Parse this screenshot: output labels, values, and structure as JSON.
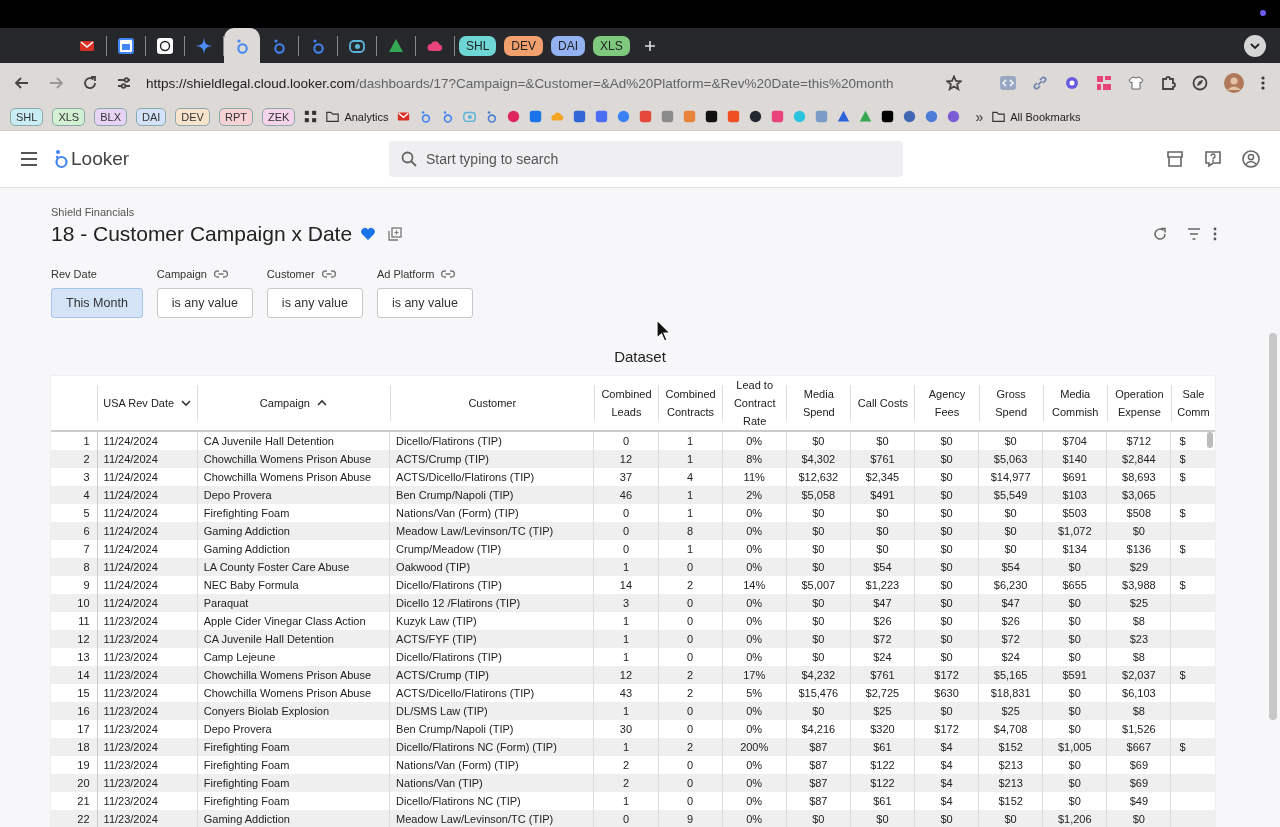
{
  "browser": {
    "tabs": [
      {
        "kind": "envelope",
        "color": "#d93025",
        "selected": false
      },
      {
        "kind": "calendar",
        "color": "#4285f4",
        "selected": false
      },
      {
        "kind": "knot",
        "color": "#ffffff",
        "selected": false
      },
      {
        "kind": "sparkle",
        "color": "#4c8df6",
        "selected": false
      },
      {
        "kind": "ring",
        "color": "#4285f4",
        "selected": true
      },
      {
        "kind": "ring",
        "color": "#4285f4",
        "selected": false
      },
      {
        "kind": "ring",
        "color": "#4285f4",
        "selected": false
      },
      {
        "kind": "lens",
        "color": "#5bb4d9",
        "selected": false
      },
      {
        "kind": "triangle",
        "color": "#34a853",
        "selected": false
      },
      {
        "kind": "cloud",
        "color": "#e8437a",
        "selected": false
      },
      {
        "kind": "chip",
        "label": "SHL",
        "color": "#6fd6d6",
        "selected": false
      },
      {
        "kind": "chip",
        "label": "DEV",
        "color": "#f2a06e",
        "selected": false
      },
      {
        "kind": "chip",
        "label": "DAI",
        "color": "#92b2f2",
        "selected": false
      },
      {
        "kind": "chip",
        "label": "XLS",
        "color": "#7fc97f",
        "selected": false
      }
    ],
    "url": {
      "host": "https://shieldlegal.cloud.looker.com",
      "path": "/dashboards/17?Campaign=&Customer=&Ad%20Platform=&Rev%20Date=this%20month"
    },
    "bookmarks": [
      {
        "kind": "chip",
        "label": "SHL",
        "color": "#c9ecf5"
      },
      {
        "kind": "chip",
        "label": "XLS",
        "color": "#d3f0d3"
      },
      {
        "kind": "chip",
        "label": "BLX",
        "color": "#e6d3f5"
      },
      {
        "kind": "chip",
        "label": "DAI",
        "color": "#d3e2f8"
      },
      {
        "kind": "chip",
        "label": "DEV",
        "color": "#f8e3cc"
      },
      {
        "kind": "chip",
        "label": "RPT",
        "color": "#f8d3d3"
      },
      {
        "kind": "chip",
        "label": "ZEK",
        "color": "#f5d3ea"
      },
      {
        "kind": "grid",
        "color": "#333333"
      },
      {
        "kind": "folder",
        "label": "Analytics"
      },
      {
        "kind": "envelope",
        "color": "#d93025"
      },
      {
        "kind": "ring",
        "color": "#4285f4"
      },
      {
        "kind": "ring",
        "color": "#4285f4"
      },
      {
        "kind": "lens",
        "color": "#5bb4d9"
      },
      {
        "kind": "ring",
        "color": "#4d7fd6"
      },
      {
        "kind": "circle",
        "color": "#e0245e"
      },
      {
        "kind": "square",
        "color": "#1a73e8"
      },
      {
        "kind": "cloud",
        "color": "#f4a623"
      },
      {
        "kind": "square",
        "color": "#3367d6"
      },
      {
        "kind": "square",
        "color": "#4c6ef5"
      },
      {
        "kind": "circle",
        "color": "#3b82f6"
      },
      {
        "kind": "square",
        "color": "#e5483b"
      },
      {
        "kind": "square",
        "color": "#8a8a8a"
      },
      {
        "kind": "square",
        "color": "#e8833a"
      },
      {
        "kind": "square",
        "color": "#111111"
      },
      {
        "kind": "square",
        "color": "#f04e23"
      },
      {
        "kind": "circle",
        "color": "#24292f"
      },
      {
        "kind": "square",
        "color": "#e8437a"
      },
      {
        "kind": "circle",
        "color": "#2ac3de"
      },
      {
        "kind": "square",
        "color": "#7a9cc6"
      },
      {
        "kind": "triangle",
        "color": "#2b63d9"
      },
      {
        "kind": "triangle",
        "color": "#34a853"
      },
      {
        "kind": "square",
        "color": "#000000"
      },
      {
        "kind": "circle",
        "color": "#4267b2"
      },
      {
        "kind": "circle",
        "color": "#4a7bd8"
      },
      {
        "kind": "circle",
        "color": "#7c5cd6"
      },
      {
        "kind": "more",
        "label": "»"
      },
      {
        "kind": "folder",
        "label": "All Bookmarks"
      }
    ]
  },
  "app": {
    "brand": "Looker",
    "search": {
      "placeholder": "Start typing to search"
    }
  },
  "dashboard": {
    "breadcrumb": "Shield Financials",
    "title": "18 - Customer Campaign x Date",
    "favorite": true,
    "filters": [
      {
        "label": "Rev Date",
        "value": "This Month",
        "active": true,
        "linked": false
      },
      {
        "label": "Campaign",
        "value": "is any value",
        "active": false,
        "linked": true
      },
      {
        "label": "Customer",
        "value": "is any value",
        "active": false,
        "linked": true
      },
      {
        "label": "Ad Platform",
        "value": "is any value",
        "active": false,
        "linked": true
      }
    ]
  },
  "tile": {
    "title": "Dataset",
    "columns": [
      {
        "label": "USA Rev Date",
        "kind": "text",
        "sorted": true,
        "descending": true
      },
      {
        "label": "Campaign",
        "kind": "text",
        "sorted": true,
        "descending": false
      },
      {
        "label": "Customer",
        "kind": "text",
        "sorted": false
      },
      {
        "label": "Combined Leads",
        "kind": "num",
        "sorted": false
      },
      {
        "label": "Combined Contracts",
        "kind": "num",
        "sorted": false
      },
      {
        "label": "Lead to Contract Rate",
        "kind": "num",
        "sorted": false
      },
      {
        "label": "Media Spend",
        "kind": "num",
        "sorted": false
      },
      {
        "label": "Call Costs",
        "kind": "num",
        "sorted": false
      },
      {
        "label": "Agency Fees",
        "kind": "num",
        "sorted": false
      },
      {
        "label": "Gross Spend",
        "kind": "num",
        "sorted": false
      },
      {
        "label": "Media Commish",
        "kind": "num",
        "sorted": false
      },
      {
        "label": "Operation Expense",
        "kind": "num",
        "sorted": false
      },
      {
        "label": "Sale Comm",
        "kind": "cut",
        "sorted": false
      }
    ],
    "rows": [
      {
        "n": "1",
        "cells": [
          "11/24/2024",
          "CA Juvenile Hall Detention",
          "Dicello/Flatirons (TIP)",
          "0",
          "1",
          "0%",
          "$0",
          "$0",
          "$0",
          "$0",
          "$704",
          "$712",
          "$"
        ]
      },
      {
        "n": "2",
        "cells": [
          "11/24/2024",
          "Chowchilla Womens Prison Abuse",
          "ACTS/Crump (TIP)",
          "12",
          "1",
          "8%",
          "$4,302",
          "$761",
          "$0",
          "$5,063",
          "$140",
          "$2,844",
          "$"
        ]
      },
      {
        "n": "3",
        "cells": [
          "11/24/2024",
          "Chowchilla Womens Prison Abuse",
          "ACTS/Dicello/Flatirons (TIP)",
          "37",
          "4",
          "11%",
          "$12,632",
          "$2,345",
          "$0",
          "$14,977",
          "$691",
          "$8,693",
          "$"
        ]
      },
      {
        "n": "4",
        "cells": [
          "11/24/2024",
          "Depo Provera",
          "Ben Crump/Napoli (TIP)",
          "46",
          "1",
          "2%",
          "$5,058",
          "$491",
          "$0",
          "$5,549",
          "$103",
          "$3,065"
        ]
      },
      {
        "n": "5",
        "cells": [
          "11/24/2024",
          "Firefighting Foam",
          "Nations/Van (Form) (TIP)",
          "0",
          "1",
          "0%",
          "$0",
          "$0",
          "$0",
          "$0",
          "$503",
          "$508",
          "$"
        ]
      },
      {
        "n": "6",
        "cells": [
          "11/24/2024",
          "Gaming Addiction",
          "Meadow Law/Levinson/TC (TIP)",
          "0",
          "8",
          "0%",
          "$0",
          "$0",
          "$0",
          "$0",
          "$1,072",
          "$0"
        ]
      },
      {
        "n": "7",
        "cells": [
          "11/24/2024",
          "Gaming Addiction",
          "Crump/Meadow (TIP)",
          "0",
          "1",
          "0%",
          "$0",
          "$0",
          "$0",
          "$0",
          "$134",
          "$136",
          "$"
        ]
      },
      {
        "n": "8",
        "cells": [
          "11/24/2024",
          "LA County Foster Care Abuse",
          "Oakwood (TIP)",
          "1",
          "0",
          "0%",
          "$0",
          "$54",
          "$0",
          "$54",
          "$0",
          "$29"
        ]
      },
      {
        "n": "9",
        "cells": [
          "11/24/2024",
          "NEC Baby Formula",
          "Dicello/Flatirons (TIP)",
          "14",
          "2",
          "14%",
          "$5,007",
          "$1,223",
          "$0",
          "$6,230",
          "$655",
          "$3,988",
          "$"
        ]
      },
      {
        "n": "10",
        "cells": [
          "11/24/2024",
          "Paraquat",
          "Dicello 12 /Flatirons (TIP)",
          "3",
          "0",
          "0%",
          "$0",
          "$47",
          "$0",
          "$47",
          "$0",
          "$25"
        ]
      },
      {
        "n": "11",
        "cells": [
          "11/23/2024",
          "Apple Cider Vinegar Class Action",
          "Kuzyk Law (TIP)",
          "1",
          "0",
          "0%",
          "$0",
          "$26",
          "$0",
          "$26",
          "$0",
          "$8"
        ]
      },
      {
        "n": "12",
        "cells": [
          "11/23/2024",
          "CA Juvenile Hall Detention",
          "ACTS/FYF (TIP)",
          "1",
          "0",
          "0%",
          "$0",
          "$72",
          "$0",
          "$72",
          "$0",
          "$23"
        ]
      },
      {
        "n": "13",
        "cells": [
          "11/23/2024",
          "Camp Lejeune",
          "Dicello/Flatirons (TIP)",
          "1",
          "0",
          "0%",
          "$0",
          "$24",
          "$0",
          "$24",
          "$0",
          "$8"
        ]
      },
      {
        "n": "14",
        "cells": [
          "11/23/2024",
          "Chowchilla Womens Prison Abuse",
          "ACTS/Crump (TIP)",
          "12",
          "2",
          "17%",
          "$4,232",
          "$761",
          "$172",
          "$5,165",
          "$591",
          "$2,037",
          "$"
        ]
      },
      {
        "n": "15",
        "cells": [
          "11/23/2024",
          "Chowchilla Womens Prison Abuse",
          "ACTS/Dicello/Flatirons (TIP)",
          "43",
          "2",
          "5%",
          "$15,476",
          "$2,725",
          "$630",
          "$18,831",
          "$0",
          "$6,103"
        ]
      },
      {
        "n": "16",
        "cells": [
          "11/23/2024",
          "Conyers Biolab Explosion",
          "DL/SMS Law (TIP)",
          "1",
          "0",
          "0%",
          "$0",
          "$25",
          "$0",
          "$25",
          "$0",
          "$8"
        ]
      },
      {
        "n": "17",
        "cells": [
          "11/23/2024",
          "Depo Provera",
          "Ben Crump/Napoli (TIP)",
          "30",
          "0",
          "0%",
          "$4,216",
          "$320",
          "$172",
          "$4,708",
          "$0",
          "$1,526"
        ]
      },
      {
        "n": "18",
        "cells": [
          "11/23/2024",
          "Firefighting Foam",
          "Dicello/Flatirons NC (Form) (TIP)",
          "1",
          "2",
          "200%",
          "$87",
          "$61",
          "$4",
          "$152",
          "$1,005",
          "$667",
          "$"
        ]
      },
      {
        "n": "19",
        "cells": [
          "11/23/2024",
          "Firefighting Foam",
          "Nations/Van (Form) (TIP)",
          "2",
          "0",
          "0%",
          "$87",
          "$122",
          "$4",
          "$213",
          "$0",
          "$69"
        ]
      },
      {
        "n": "20",
        "cells": [
          "11/23/2024",
          "Firefighting Foam",
          "Nations/Van (TIP)",
          "2",
          "0",
          "0%",
          "$87",
          "$122",
          "$4",
          "$213",
          "$0",
          "$69"
        ]
      },
      {
        "n": "21",
        "cells": [
          "11/23/2024",
          "Firefighting Foam",
          "Dicello/Flatirons NC (TIP)",
          "1",
          "0",
          "0%",
          "$87",
          "$61",
          "$4",
          "$152",
          "$0",
          "$49"
        ]
      },
      {
        "n": "22",
        "cells": [
          "11/23/2024",
          "Gaming Addiction",
          "Meadow Law/Levinson/TC (TIP)",
          "0",
          "9",
          "0%",
          "$0",
          "$0",
          "$0",
          "$0",
          "$1,206",
          "$0"
        ]
      }
    ]
  }
}
